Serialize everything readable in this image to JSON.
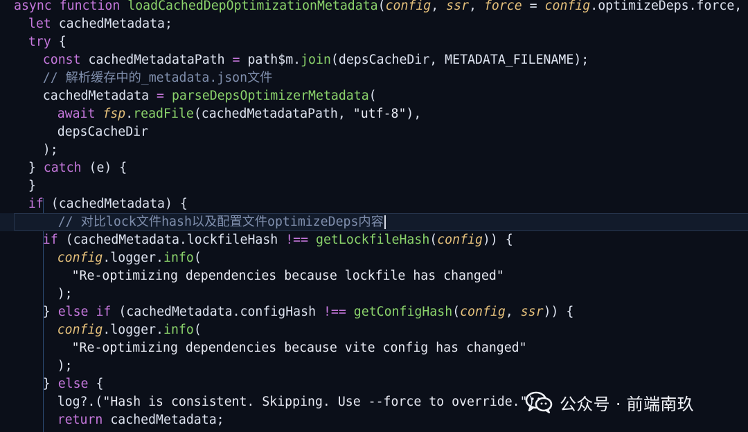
{
  "lines": [
    {
      "indent": 0,
      "tokens": [
        {
          "text": "async",
          "type": "kw"
        },
        {
          "text": " ",
          "type": "punc"
        },
        {
          "text": "function",
          "type": "kw"
        },
        {
          "text": " ",
          "type": "punc"
        },
        {
          "text": "loadCachedDepOptimizationMetadata",
          "type": "fn"
        },
        {
          "text": "(",
          "type": "punc"
        },
        {
          "text": "config",
          "type": "param"
        },
        {
          "text": ", ",
          "type": "punc"
        },
        {
          "text": "ssr",
          "type": "param"
        },
        {
          "text": ", ",
          "type": "punc"
        },
        {
          "text": "force",
          "type": "param"
        },
        {
          "text": " = ",
          "type": "punc"
        },
        {
          "text": "config",
          "type": "param"
        },
        {
          "text": ".optimizeDeps.force,",
          "type": "punc"
        }
      ]
    },
    {
      "indent": 2,
      "tokens": [
        {
          "text": "let",
          "type": "kw"
        },
        {
          "text": " cachedMetadata;",
          "type": "var"
        }
      ]
    },
    {
      "indent": 2,
      "tokens": [
        {
          "text": "try",
          "type": "kw"
        },
        {
          "text": " {",
          "type": "punc"
        }
      ]
    },
    {
      "indent": 4,
      "tokens": [
        {
          "text": "const",
          "type": "kw"
        },
        {
          "text": " cachedMetadataPath ",
          "type": "var"
        },
        {
          "text": "=",
          "type": "op"
        },
        {
          "text": " path$m.",
          "type": "var"
        },
        {
          "text": "join",
          "type": "fn"
        },
        {
          "text": "(depsCacheDir, METADATA_FILENAME);",
          "type": "var"
        }
      ]
    },
    {
      "indent": 4,
      "tokens": [
        {
          "text": "// 解析缓存中的_metadata.json文件",
          "type": "comment"
        }
      ]
    },
    {
      "indent": 4,
      "tokens": [
        {
          "text": "cachedMetadata ",
          "type": "var"
        },
        {
          "text": "=",
          "type": "op"
        },
        {
          "text": " ",
          "type": "punc"
        },
        {
          "text": "parseDepsOptimizerMetadata",
          "type": "fn"
        },
        {
          "text": "(",
          "type": "punc"
        }
      ]
    },
    {
      "indent": 6,
      "tokens": [
        {
          "text": "await",
          "type": "kw"
        },
        {
          "text": " ",
          "type": "punc"
        },
        {
          "text": "fsp",
          "type": "param"
        },
        {
          "text": ".",
          "type": "punc"
        },
        {
          "text": "readFile",
          "type": "fn"
        },
        {
          "text": "(cachedMetadataPath, ",
          "type": "var"
        },
        {
          "text": "\"utf-8\"",
          "type": "str"
        },
        {
          "text": "),",
          "type": "punc"
        }
      ]
    },
    {
      "indent": 6,
      "tokens": [
        {
          "text": "depsCacheDir",
          "type": "var"
        }
      ]
    },
    {
      "indent": 4,
      "tokens": [
        {
          "text": ");",
          "type": "punc"
        }
      ]
    },
    {
      "indent": 2,
      "tokens": [
        {
          "text": "} ",
          "type": "punc"
        },
        {
          "text": "catch",
          "type": "kw"
        },
        {
          "text": " (e) {",
          "type": "punc"
        }
      ]
    },
    {
      "indent": 2,
      "tokens": [
        {
          "text": "}",
          "type": "punc"
        }
      ]
    },
    {
      "indent": 2,
      "tokens": [
        {
          "text": "if",
          "type": "kw"
        },
        {
          "text": " (cachedMetadata) {",
          "type": "var"
        }
      ]
    },
    {
      "indent": 4,
      "current": true,
      "tokens": [
        {
          "text": "  // 对比lock文件hash以及配置文件optimizeDeps内容",
          "type": "comment"
        }
      ]
    },
    {
      "indent": 4,
      "tokens": [
        {
          "text": "if",
          "type": "kw"
        },
        {
          "text": " (cachedMetadata.lockfileHash ",
          "type": "var"
        },
        {
          "text": "!==",
          "type": "op"
        },
        {
          "text": " ",
          "type": "punc"
        },
        {
          "text": "getLockfileHash",
          "type": "fn"
        },
        {
          "text": "(",
          "type": "punc"
        },
        {
          "text": "config",
          "type": "param"
        },
        {
          "text": ")) {",
          "type": "punc"
        }
      ]
    },
    {
      "indent": 6,
      "tokens": [
        {
          "text": "config",
          "type": "param"
        },
        {
          "text": ".logger.",
          "type": "var"
        },
        {
          "text": "info",
          "type": "fn"
        },
        {
          "text": "(",
          "type": "punc"
        }
      ]
    },
    {
      "indent": 8,
      "tokens": [
        {
          "text": "\"Re-optimizing dependencies because lockfile has changed\"",
          "type": "str"
        }
      ]
    },
    {
      "indent": 6,
      "tokens": [
        {
          "text": ");",
          "type": "punc"
        }
      ]
    },
    {
      "indent": 4,
      "tokens": [
        {
          "text": "} ",
          "type": "punc"
        },
        {
          "text": "else",
          "type": "kw"
        },
        {
          "text": " ",
          "type": "punc"
        },
        {
          "text": "if",
          "type": "kw"
        },
        {
          "text": " (cachedMetadata.configHash ",
          "type": "var"
        },
        {
          "text": "!==",
          "type": "op"
        },
        {
          "text": " ",
          "type": "punc"
        },
        {
          "text": "getConfigHash",
          "type": "fn"
        },
        {
          "text": "(",
          "type": "punc"
        },
        {
          "text": "config",
          "type": "param"
        },
        {
          "text": ", ",
          "type": "punc"
        },
        {
          "text": "ssr",
          "type": "param"
        },
        {
          "text": ")) {",
          "type": "punc"
        }
      ]
    },
    {
      "indent": 6,
      "tokens": [
        {
          "text": "config",
          "type": "param"
        },
        {
          "text": ".logger.",
          "type": "var"
        },
        {
          "text": "info",
          "type": "fn"
        },
        {
          "text": "(",
          "type": "punc"
        }
      ]
    },
    {
      "indent": 8,
      "tokens": [
        {
          "text": "\"Re-optimizing dependencies because vite config has changed\"",
          "type": "str"
        }
      ]
    },
    {
      "indent": 6,
      "tokens": [
        {
          "text": ");",
          "type": "punc"
        }
      ]
    },
    {
      "indent": 4,
      "tokens": [
        {
          "text": "} ",
          "type": "punc"
        },
        {
          "text": "else",
          "type": "kw"
        },
        {
          "text": " {",
          "type": "punc"
        }
      ]
    },
    {
      "indent": 6,
      "tokens": [
        {
          "text": "log?.(",
          "type": "var"
        },
        {
          "text": "\"Hash is consistent. Skipping. Use --force to override.\"",
          "type": "str"
        },
        {
          "text": ");",
          "type": "punc"
        }
      ]
    },
    {
      "indent": 6,
      "tokens": [
        {
          "text": "return",
          "type": "kw"
        },
        {
          "text": " cachedMetadata;",
          "type": "var"
        }
      ]
    }
  ],
  "watermark": {
    "icon": "wechat-icon",
    "text": "公众号 · 前端南玖"
  },
  "colors": {
    "background": "#0b0f19",
    "keyword": "#c678dd",
    "function": "#8bd36b",
    "parameter": "#e5c07b",
    "comment": "#7f8eac",
    "default": "#dde3f0"
  }
}
